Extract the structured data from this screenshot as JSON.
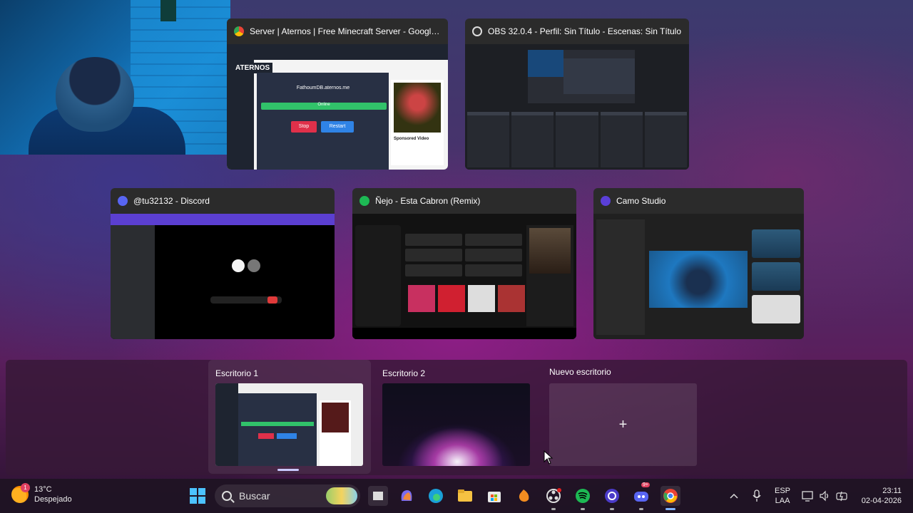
{
  "windows": [
    {
      "title": "Server | Aternos | Free Minecraft Server - Google Ch...",
      "app": "chrome-icon"
    },
    {
      "title": "OBS 32.0.4 - Perfil: Sin Título - Escenas: Sin Título",
      "app": "obs-icon"
    },
    {
      "title": "@tu32132 - Discord",
      "app": "discord-icon"
    },
    {
      "title": "Ñejo - Esta Cabron (Remix)",
      "app": "spotify-icon"
    },
    {
      "title": "Camo Studio",
      "app": "camo-icon"
    }
  ],
  "aternos_preview": {
    "logo": "ATERNOS",
    "server": "FathoumDB.aternos.me",
    "status": "Online",
    "stop": "Stop",
    "restart": "Restart",
    "ad_label": "Sponsored Video"
  },
  "desktops": [
    {
      "label": "Escritorio 1",
      "active": true
    },
    {
      "label": "Escritorio 2",
      "active": false
    }
  ],
  "new_desktop": {
    "label": "Nuevo escritorio",
    "plus": "+"
  },
  "taskbar": {
    "weather_temp": "13°C",
    "weather_desc": "Despejado",
    "weather_badge": "1",
    "search_placeholder": "Buscar",
    "discord_badge": "9+",
    "lang_top": "ESP",
    "lang_bottom": "LAA",
    "time": "23:11",
    "date": "02-04-2026"
  },
  "colors": {
    "accent": "#7fb4ff",
    "spotify": "#1db954",
    "discord": "#5865f2",
    "chrome": "#4285f4"
  }
}
